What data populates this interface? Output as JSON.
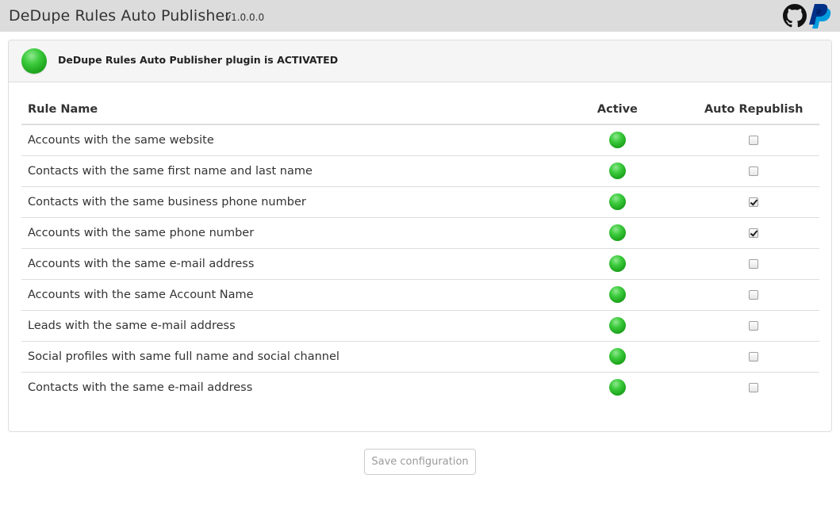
{
  "header": {
    "title": "DeDupe Rules Auto Publisher",
    "version": "v1.0.0.0",
    "icons": [
      "github-icon",
      "paypal-icon"
    ]
  },
  "status": {
    "text": "DeDupe Rules Auto Publisher plugin is ACTIVATED",
    "color": "#2ebd2e"
  },
  "table": {
    "columns": [
      "Rule Name",
      "Active",
      "Auto Republish"
    ],
    "rows": [
      {
        "name": "Accounts with the same website",
        "active": true,
        "auto_republish": false
      },
      {
        "name": "Contacts with the same first name and last name",
        "active": true,
        "auto_republish": false
      },
      {
        "name": "Contacts with the same business phone number",
        "active": true,
        "auto_republish": true
      },
      {
        "name": "Accounts with the same phone number",
        "active": true,
        "auto_republish": true
      },
      {
        "name": "Accounts with the same e-mail address",
        "active": true,
        "auto_republish": false
      },
      {
        "name": "Accounts with the same Account Name",
        "active": true,
        "auto_republish": false
      },
      {
        "name": "Leads with the same e-mail address",
        "active": true,
        "auto_republish": false
      },
      {
        "name": "Social profiles with same full name and social channel",
        "active": true,
        "auto_republish": false
      },
      {
        "name": "Contacts with the same e-mail address",
        "active": true,
        "auto_republish": false
      }
    ]
  },
  "footer": {
    "save_label": "Save configuration"
  }
}
